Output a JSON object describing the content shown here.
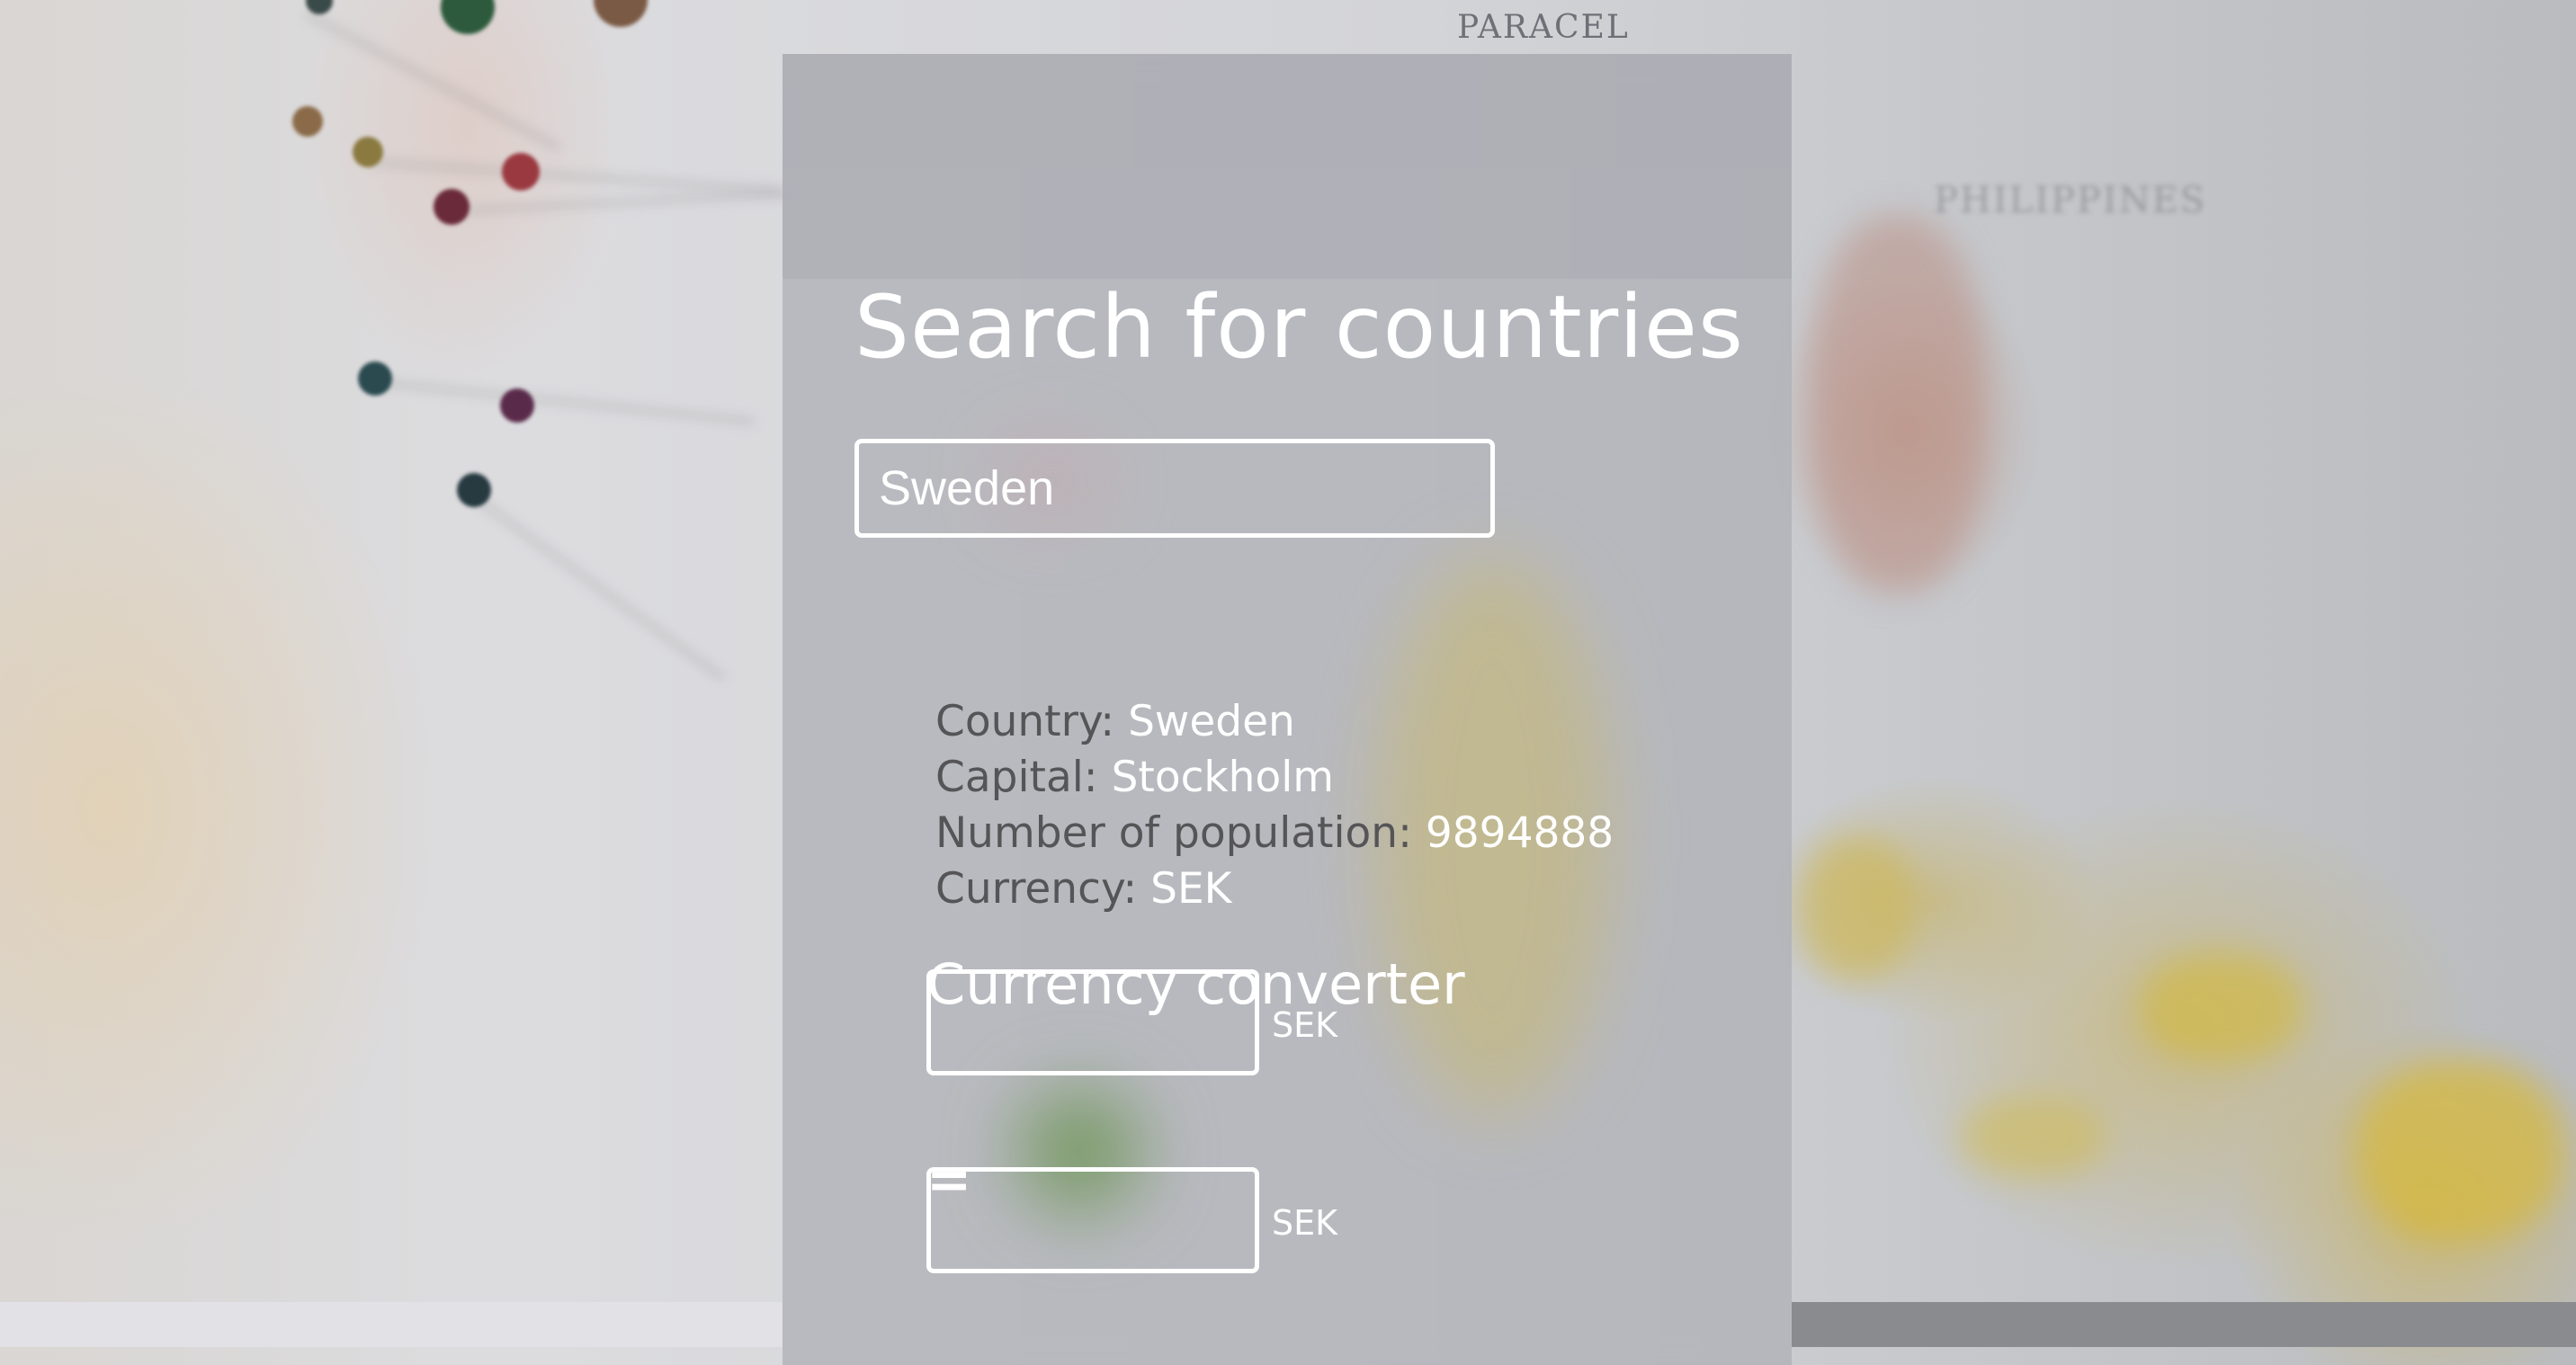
{
  "search": {
    "title": "Search for countries",
    "input_value": "Sweden"
  },
  "country_info": {
    "country_label": "Country: ",
    "country_value": "Sweden",
    "capital_label": "Capital: ",
    "capital_value": "Stockholm",
    "population_label": "Number of population: ",
    "population_value": "9894888",
    "currency_label": "Currency: ",
    "currency_value": "SEK"
  },
  "converter": {
    "title": "Currency converter",
    "from_unit": "SEK",
    "equals_sign": "=",
    "to_unit": "SEK"
  },
  "background_map_labels": {
    "paracel": "PARACEL",
    "philippines": "PHILIPPINES"
  },
  "colors": {
    "panel": "#b0b1b7",
    "text_white": "#ffffff",
    "label_gray": "#555558"
  }
}
